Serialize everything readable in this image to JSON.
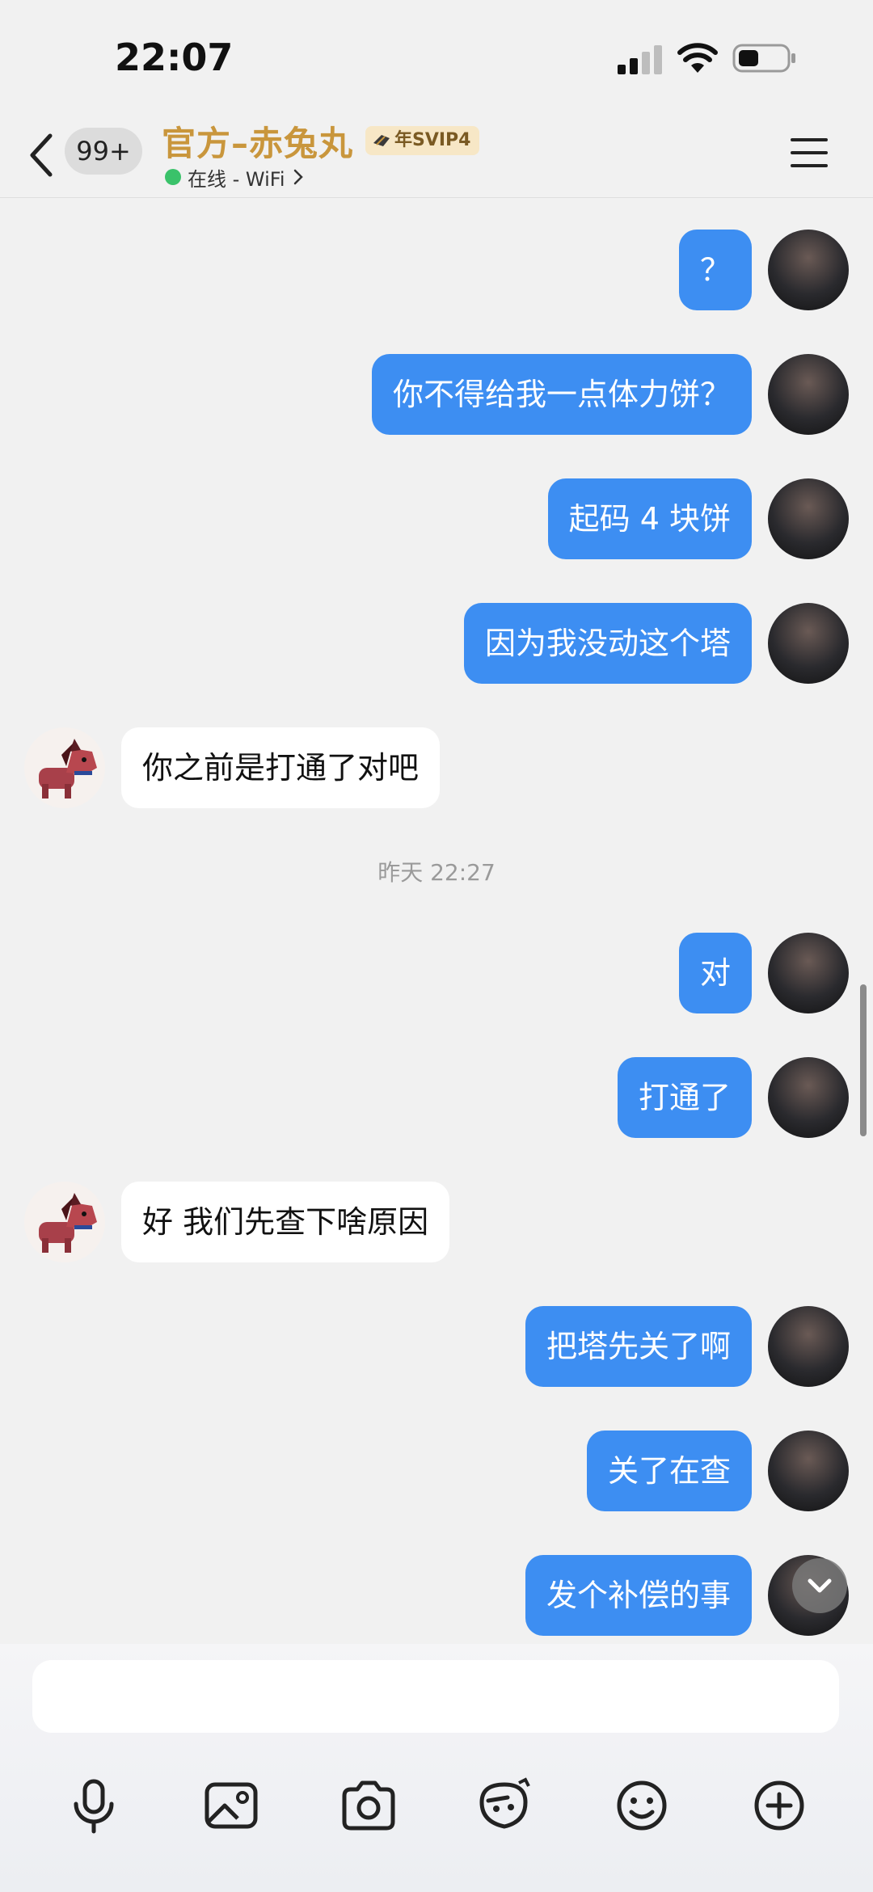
{
  "status": {
    "time": "22:07"
  },
  "header": {
    "unread": "99+",
    "contact_name": "官方–赤兔丸",
    "vip_label": "年SVIP4",
    "online_text": "在线 - WiFi"
  },
  "messages": [
    {
      "from": "me",
      "text": "？"
    },
    {
      "from": "me",
      "text": "你不得给我一点体力饼？"
    },
    {
      "from": "me",
      "text": "起码 4 块饼"
    },
    {
      "from": "me",
      "text": "因为我没动这个塔"
    },
    {
      "from": "them",
      "text": "你之前是打通了对吧"
    },
    {
      "from": "me",
      "text": "对"
    },
    {
      "from": "me",
      "text": "打通了"
    },
    {
      "from": "them",
      "text": "好 我们先查下啥原因"
    },
    {
      "from": "me",
      "text": "把塔先关了啊"
    },
    {
      "from": "me",
      "text": "关了在查"
    },
    {
      "from": "me",
      "text": "发个补偿的事"
    }
  ],
  "timestamp": "昨天 22:27",
  "input": {
    "value": "",
    "placeholder": ""
  },
  "toolbar": {
    "icons": [
      "microphone-icon",
      "image-icon",
      "camera-icon",
      "sticker-edit-icon",
      "emoji-icon",
      "plus-icon"
    ]
  },
  "colors": {
    "my_bubble": "#3d8ef2",
    "their_bubble": "#ffffff",
    "contact_name": "#c9963c",
    "online": "#3ac26a",
    "background": "#f1f1f1"
  }
}
